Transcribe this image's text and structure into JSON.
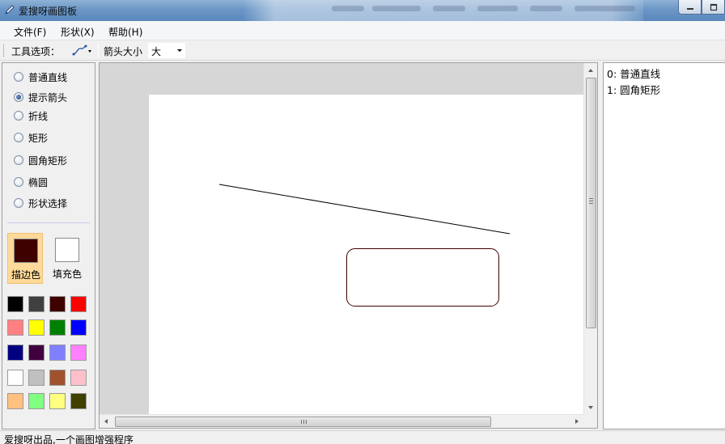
{
  "window": {
    "title": "爱搜呀画图板"
  },
  "menu": [
    {
      "label": "文件(F)"
    },
    {
      "label": "形状(X)"
    },
    {
      "label": "帮助(H)"
    }
  ],
  "toolbar": {
    "tool_options_label": "工具选项：",
    "arrow_size_label": "箭头大小",
    "arrow_size_value": "大"
  },
  "shape_tools": [
    {
      "label": "普通直线",
      "checked": false
    },
    {
      "label": "提示箭头",
      "checked": true
    },
    {
      "label": "折线",
      "checked": false
    },
    {
      "label": "矩形",
      "checked": false
    },
    {
      "label": "圆角矩形",
      "checked": false
    },
    {
      "label": "椭圆",
      "checked": false
    },
    {
      "label": "形状选择",
      "checked": false
    }
  ],
  "colors": {
    "stroke_label": "描边色",
    "fill_label": "填充色",
    "stroke_color": "#3f0000",
    "fill_color": "#ffffff",
    "palette": [
      [
        "#000000",
        "#404040",
        "#3f0000",
        "#ff0000"
      ],
      [
        "#ff8080",
        "#ffff00",
        "#008000",
        "#0000ff"
      ],
      [
        "#000080",
        "#400040",
        "#8080ff",
        "#ff80ff"
      ],
      [
        "#ffffff",
        "#c0c0c0",
        "#a0522d",
        "#ffc0cb"
      ],
      [
        "#ffc080",
        "#80ff80",
        "#ffff80",
        "#404000"
      ]
    ]
  },
  "shape_list": [
    {
      "label": "0: 普通直线"
    },
    {
      "label": "1: 圆角矩形"
    }
  ],
  "status": {
    "text": "爱搜呀出品,一个画图增强程序"
  }
}
